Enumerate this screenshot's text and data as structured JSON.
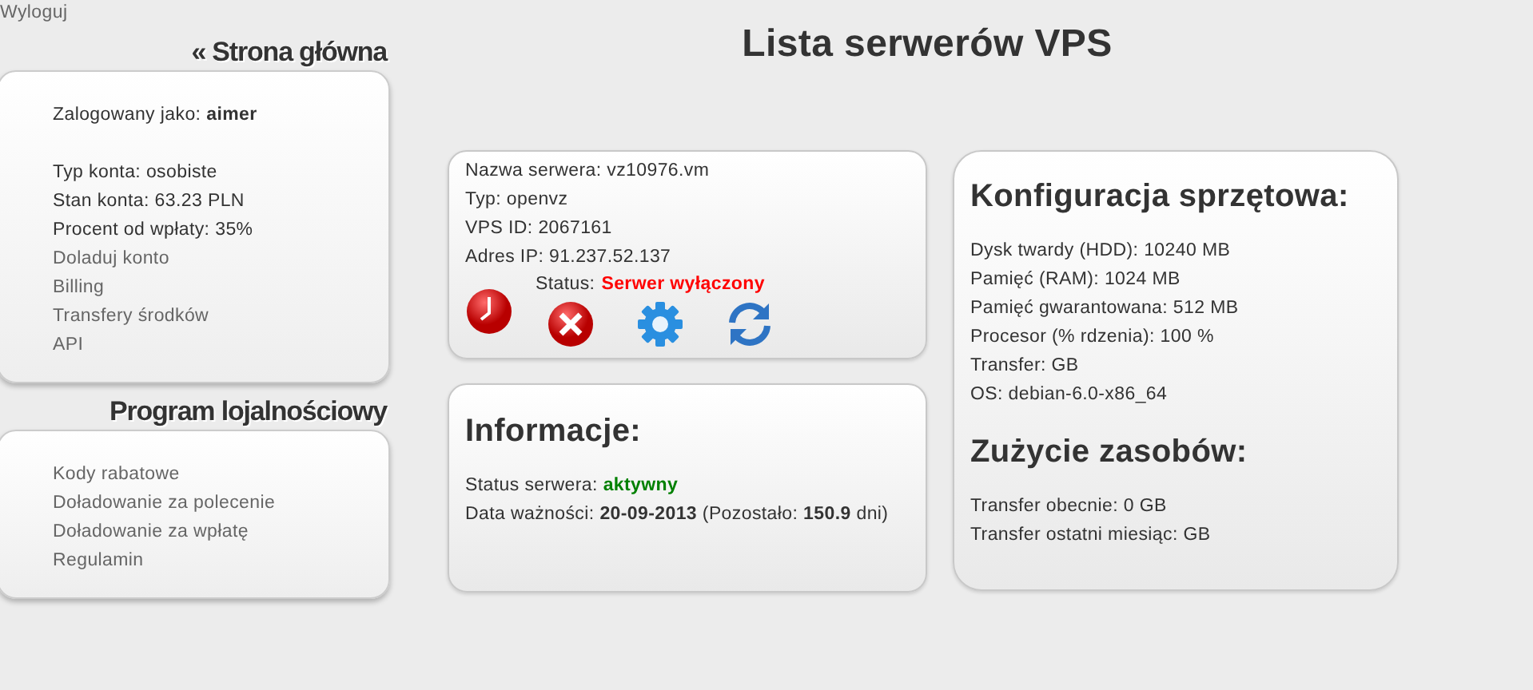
{
  "logout": "Wyloguj",
  "sidebar": [
    {
      "heading": "« Strona główna",
      "items": [
        {
          "kind": "spacer"
        },
        {
          "kind": "text",
          "text": "Zalogowany jako: **aimer**"
        },
        {
          "kind": "spacer"
        },
        {
          "kind": "text",
          "text": "Typ konta: osobiste"
        },
        {
          "kind": "text",
          "text": "Stan konta: 63.23 PLN"
        },
        {
          "kind": "text",
          "text": "Procent od wpłaty: 35%"
        },
        {
          "kind": "link",
          "text": "Doladuj konto"
        },
        {
          "kind": "link",
          "text": "Billing"
        },
        {
          "kind": "link",
          "text": "Transfery środków"
        },
        {
          "kind": "link",
          "text": "API"
        }
      ]
    },
    {
      "heading": "Program lojalnościowy",
      "items": [
        {
          "kind": "spacer"
        },
        {
          "kind": "link",
          "text": "Kody rabatowe"
        },
        {
          "kind": "link",
          "text": "Doładowanie za polecenie"
        },
        {
          "kind": "link",
          "text": "Doładowanie za wpłatę"
        },
        {
          "kind": "link",
          "text": "Regulamin"
        }
      ]
    }
  ],
  "title": "Lista serwerów VPS",
  "server": {
    "lines": [
      "Nazwa serwera: vz10976.vm",
      "Typ: openvz",
      "VPS ID: 2067161",
      "Adres IP: 91.237.52.137"
    ],
    "status_label": "Status:",
    "status_value": "Serwer wyłączony",
    "running": false,
    "actions": [
      {
        "kind": "start"
      },
      {
        "kind": "stop"
      },
      {
        "kind": "settings"
      },
      {
        "kind": "restart"
      }
    ]
  },
  "info": {
    "heading": "Informacje:",
    "lines": [
      {
        "label": "Status serwera:",
        "value": "aktywny",
        "active": true
      },
      {
        "label": "Data ważności: **20-09-2013** (Pozostało: **150.9** dni)"
      }
    ]
  },
  "config": {
    "heading": "Konfiguracja sprzętowa:",
    "lines": [
      "Dysk twardy (HDD): 10240 MB",
      "Pamięć (RAM): 1024 MB",
      "Pamięć gwarantowana: 512 MB",
      "Procesor (% rdzenia): 100 %",
      "Transfer: GB",
      "OS: debian-6.0-x86_64"
    ]
  },
  "usage": {
    "heading": "Zużycie zasobów:",
    "lines": [
      "Transfer obecnie: 0 GB",
      "Transfer ostatni miesiąc: GB"
    ]
  }
}
